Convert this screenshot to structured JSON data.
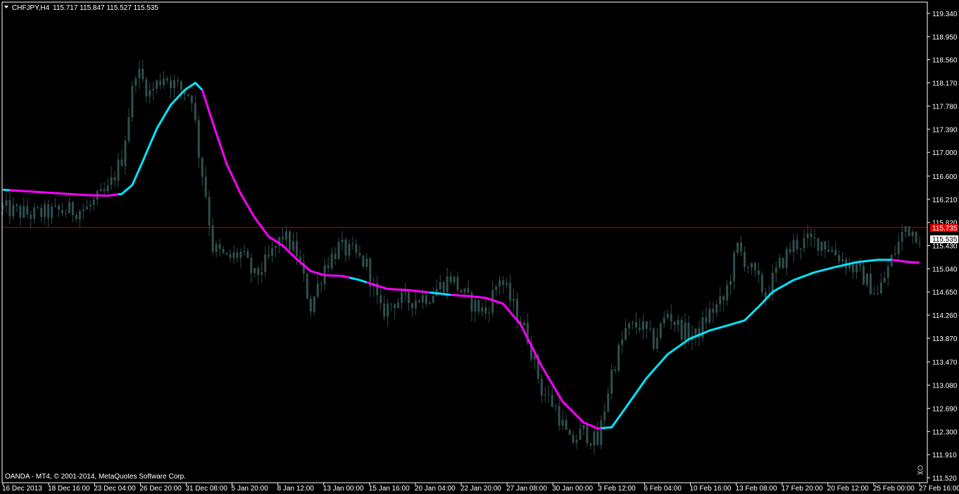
{
  "header": {
    "symbol_label": "CHFJPY,H4",
    "ohlc": "115.717 115.847 115.527 115.535"
  },
  "footer": {
    "copyright": "OANDA - MT4, © 2001-2014, MetaQuotes Software Corp."
  },
  "colors": {
    "background": "#000000",
    "frame": "#ffffff",
    "candles": "#2f4f4f",
    "ma_up": "#00e5ff",
    "ma_down": "#ff00ff",
    "price_line": "#c00000",
    "bid_badge": "#e00000"
  },
  "chart_data": {
    "type": "line",
    "title": "CHFJPY,H4",
    "y_ticks": [
      "119.340",
      "118.950",
      "118.560",
      "118.170",
      "117.780",
      "117.390",
      "117.000",
      "116.600",
      "116.210",
      "115.820",
      "115.430",
      "115.040",
      "114.650",
      "114.260",
      "113.870",
      "113.470",
      "113.080",
      "112.690",
      "112.300",
      "111.910",
      "111.520"
    ],
    "ylim": [
      111.52,
      119.34
    ],
    "x_ticks": [
      "16 Dec 2013",
      "18 Dec 16:00",
      "23 Dec 04:00",
      "26 Dec 20:00",
      "31 Dec 08:00",
      "5 Jan 20:00",
      "8 Jan 12:00",
      "13 Jan 00:00",
      "15 Jan 16:00",
      "20 Jan 04:00",
      "22 Jan 20:00",
      "27 Jan 08:00",
      "30 Jan 00:00",
      "3 Feb 12:00",
      "6 Feb 04:00",
      "10 Feb 16:00",
      "13 Feb 08:00",
      "17 Feb 20:00",
      "20 Feb 12:00",
      "25 Feb 00:00",
      "27 Feb 16:00"
    ],
    "current_price_line": 115.735,
    "labels": {
      "red_badge": "115.735",
      "white_badge": "115.535"
    },
    "grid": false,
    "legend": "none",
    "series": [
      {
        "kind": "moving-average",
        "points": [
          [
            0,
            116.37
          ],
          [
            8,
            116.34
          ],
          [
            16,
            116.31
          ],
          [
            24,
            116.28
          ],
          [
            30,
            116.27
          ],
          [
            34,
            116.3
          ],
          [
            37,
            116.45
          ],
          [
            40,
            116.85
          ],
          [
            44,
            117.4
          ],
          [
            48,
            117.8
          ],
          [
            52,
            118.05
          ],
          [
            55,
            118.17
          ],
          [
            57,
            118.05
          ],
          [
            60,
            117.5
          ],
          [
            64,
            116.8
          ],
          [
            68,
            116.3
          ],
          [
            72,
            115.9
          ],
          [
            76,
            115.58
          ],
          [
            80,
            115.43
          ],
          [
            84,
            115.2
          ],
          [
            88,
            115.0
          ],
          [
            92,
            114.93
          ],
          [
            97,
            114.92
          ],
          [
            102,
            114.85
          ],
          [
            106,
            114.77
          ],
          [
            110,
            114.7
          ],
          [
            116,
            114.68
          ],
          [
            122,
            114.64
          ],
          [
            128,
            114.6
          ],
          [
            133,
            114.58
          ],
          [
            138,
            114.55
          ],
          [
            143,
            114.45
          ],
          [
            148,
            114.1
          ],
          [
            154,
            113.4
          ],
          [
            160,
            112.8
          ],
          [
            166,
            112.45
          ],
          [
            170,
            112.35
          ],
          [
            174,
            112.37
          ],
          [
            178,
            112.7
          ],
          [
            184,
            113.2
          ],
          [
            190,
            113.6
          ],
          [
            196,
            113.85
          ],
          [
            202,
            114.0
          ],
          [
            208,
            114.1
          ],
          [
            212,
            114.17
          ],
          [
            216,
            114.4
          ],
          [
            220,
            114.65
          ],
          [
            226,
            114.85
          ],
          [
            232,
            114.98
          ],
          [
            238,
            115.07
          ],
          [
            244,
            115.15
          ],
          [
            250,
            115.19
          ],
          [
            254,
            115.19
          ],
          [
            258,
            115.16
          ],
          [
            262,
            115.14
          ]
        ],
        "color_segments": [
          {
            "from": 0,
            "to": 2,
            "color": "up"
          },
          {
            "from": 2,
            "to": 33,
            "color": "down"
          },
          {
            "from": 33,
            "to": 57,
            "color": "up"
          },
          {
            "from": 57,
            "to": 99,
            "color": "down"
          },
          {
            "from": 99,
            "to": 104,
            "color": "up"
          },
          {
            "from": 104,
            "to": 122,
            "color": "down"
          },
          {
            "from": 122,
            "to": 128,
            "color": "up"
          },
          {
            "from": 128,
            "to": 171,
            "color": "down"
          },
          {
            "from": 171,
            "to": 254,
            "color": "up"
          },
          {
            "from": 254,
            "to": 262,
            "color": "down"
          }
        ]
      }
    ],
    "candle_anchors": [
      [
        0,
        116.05
      ],
      [
        8,
        115.95
      ],
      [
        16,
        116.0
      ],
      [
        24,
        116.05
      ],
      [
        30,
        116.35
      ],
      [
        34,
        116.9
      ],
      [
        38,
        118.4
      ],
      [
        42,
        118.0
      ],
      [
        46,
        118.3
      ],
      [
        50,
        118.1
      ],
      [
        54,
        117.95
      ],
      [
        56,
        117.0
      ],
      [
        58,
        116.3
      ],
      [
        60,
        115.4
      ],
      [
        64,
        115.2
      ],
      [
        68,
        115.3
      ],
      [
        72,
        114.9
      ],
      [
        76,
        115.2
      ],
      [
        80,
        115.6
      ],
      [
        84,
        115.3
      ],
      [
        88,
        114.4
      ],
      [
        92,
        115.1
      ],
      [
        96,
        115.4
      ],
      [
        100,
        115.3
      ],
      [
        104,
        115.1
      ],
      [
        108,
        114.3
      ],
      [
        112,
        114.5
      ],
      [
        116,
        114.5
      ],
      [
        122,
        114.6
      ],
      [
        128,
        114.9
      ],
      [
        133,
        114.5
      ],
      [
        138,
        114.3
      ],
      [
        142,
        114.9
      ],
      [
        146,
        114.4
      ],
      [
        150,
        113.9
      ],
      [
        154,
        113.0
      ],
      [
        158,
        112.7
      ],
      [
        162,
        112.1
      ],
      [
        166,
        112.3
      ],
      [
        170,
        112.1
      ],
      [
        174,
        113.3
      ],
      [
        178,
        114.0
      ],
      [
        182,
        114.1
      ],
      [
        186,
        113.8
      ],
      [
        190,
        114.3
      ],
      [
        194,
        114.0
      ],
      [
        198,
        113.9
      ],
      [
        202,
        114.3
      ],
      [
        206,
        114.5
      ],
      [
        210,
        115.4
      ],
      [
        214,
        115.0
      ],
      [
        218,
        114.6
      ],
      [
        222,
        115.1
      ],
      [
        226,
        115.45
      ],
      [
        230,
        115.5
      ],
      [
        234,
        115.5
      ],
      [
        238,
        115.3
      ],
      [
        242,
        115.1
      ],
      [
        246,
        114.9
      ],
      [
        250,
        114.6
      ],
      [
        254,
        115.2
      ],
      [
        258,
        115.75
      ],
      [
        262,
        115.6
      ]
    ],
    "candle_count": 263
  }
}
